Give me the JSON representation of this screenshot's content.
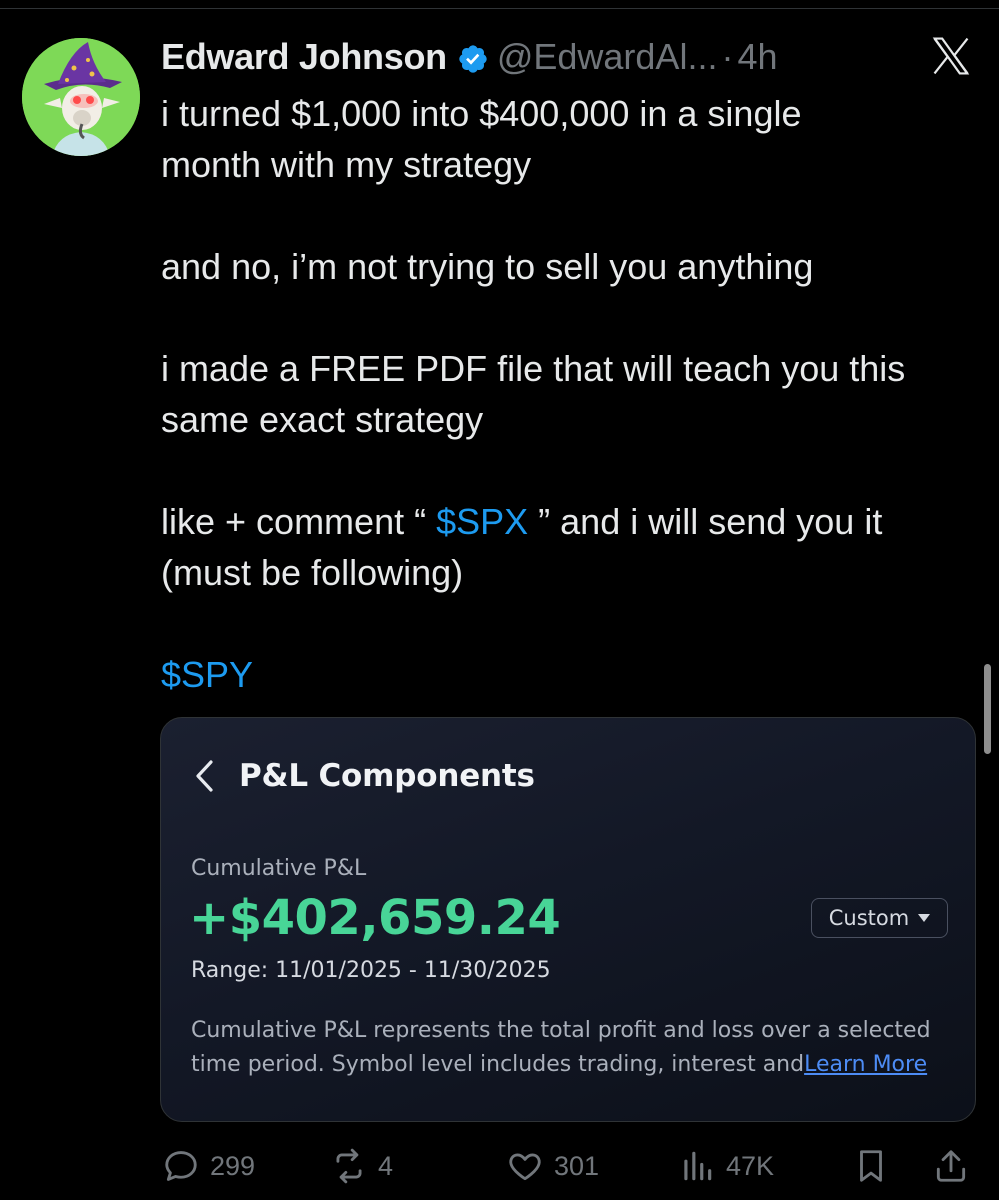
{
  "author": {
    "display_name": "Edward Johnson",
    "handle": "@EdwardAl...",
    "separator": "·",
    "age": "4h",
    "verified": true
  },
  "tweet": {
    "lines": [
      "i turned $1,000 into $400,000 in a single",
      "month with my strategy",
      "",
      "and no, i’m not trying to sell you anything",
      "",
      "i made a FREE PDF file that will teach you this",
      "same exact strategy",
      ""
    ],
    "comment_prefix": "like + comment “ ",
    "comment_cashtag": "$SPX",
    "comment_suffix": " ” and i will send you it",
    "follow_note": "(must be following)",
    "trailing_cashtag": "$SPY"
  },
  "media": {
    "title": "P&L Components",
    "cumulative_label": "Cumulative P&L",
    "cumulative_value": "+$402,659.24",
    "range": "Range: 11/01/2025 - 11/30/2025",
    "period_select": "Custom",
    "description": "Cumulative P&L represents the total profit and loss over a selected time period. Symbol level includes trading, interest and",
    "learn_more": "Learn More"
  },
  "actions": {
    "replies": "299",
    "reposts": "4",
    "likes": "301",
    "views": "47K"
  },
  "colors": {
    "background": "#000000",
    "text": "#e7e9ea",
    "muted": "#71767b",
    "link": "#1d9bf0",
    "profit": "#48d597",
    "card_link": "#4d8cf5"
  },
  "icons": [
    "x-logo-icon",
    "verified-badge-icon",
    "chevron-left-icon",
    "caret-down-icon",
    "reply-icon",
    "repost-icon",
    "like-icon",
    "views-icon",
    "bookmark-icon",
    "share-icon"
  ]
}
